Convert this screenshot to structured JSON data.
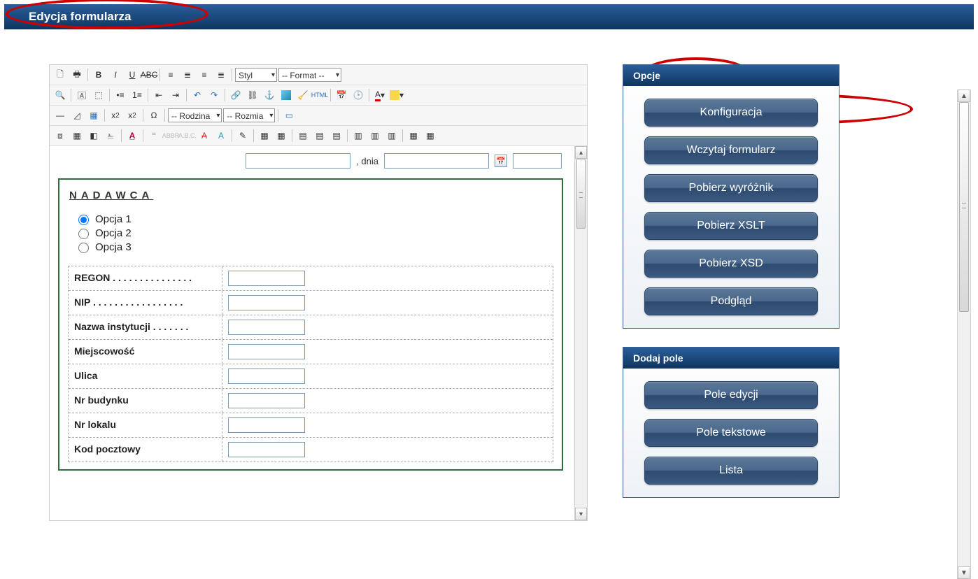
{
  "pageTitle": "Edycja formularza",
  "toolbar": {
    "styleLabel": "Styl",
    "formatLabel": "-- Format --",
    "fontFamilyLabel": "-- Rodzina",
    "fontSizeLabel": "-- Rozmia"
  },
  "dateRow": {
    "label": ", dnia"
  },
  "form": {
    "sectionHeader": "NADAWCA",
    "radios": [
      {
        "label": "Opcja 1",
        "checked": true
      },
      {
        "label": "Opcja 2",
        "checked": false
      },
      {
        "label": "Opcja 3",
        "checked": false
      }
    ],
    "fields": [
      {
        "label": "REGON . . . . . . . . . . . . . . ."
      },
      {
        "label": "NIP  . . . . . . . . . . . . . . . . ."
      },
      {
        "label": "Nazwa instytucji . . . . . . ."
      },
      {
        "label": "Miejscowość"
      },
      {
        "label": "Ulica"
      },
      {
        "label": "Nr budynku"
      },
      {
        "label": "Nr lokalu"
      },
      {
        "label": "Kod pocztowy"
      }
    ]
  },
  "panels": {
    "opcje": {
      "title": "Opcje",
      "buttons": [
        "Konfiguracja",
        "Wczytaj formularz",
        "Pobierz wyróżnik",
        "Pobierz XSLT",
        "Pobierz XSD",
        "Podgląd"
      ]
    },
    "dodajPole": {
      "title": "Dodaj pole",
      "buttons": [
        "Pole edycji",
        "Pole tekstowe",
        "Lista"
      ]
    }
  }
}
